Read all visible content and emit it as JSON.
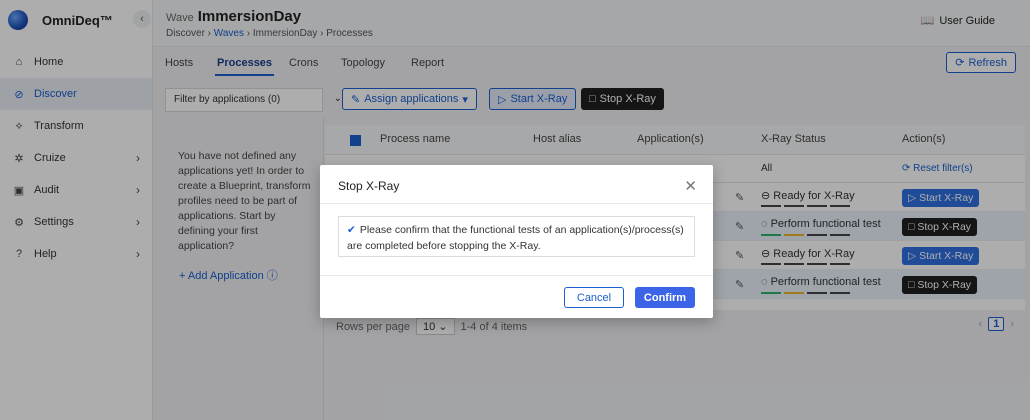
{
  "brand": {
    "name": "OmniDeq™"
  },
  "sidebar": {
    "items": [
      {
        "label": "Home",
        "icon": "home-icon"
      },
      {
        "label": "Discover",
        "icon": "discover-icon"
      },
      {
        "label": "Transform",
        "icon": "transform-icon"
      },
      {
        "label": "Cruize",
        "icon": "cruize-icon"
      },
      {
        "label": "Audit",
        "icon": "audit-icon"
      },
      {
        "label": "Settings",
        "icon": "gear-icon"
      },
      {
        "label": "Help",
        "icon": "help-icon"
      }
    ]
  },
  "header": {
    "prefix": "Wave",
    "title": "ImmersionDay",
    "breadcrumb": {
      "b1": "Discover",
      "b2": "Waves",
      "b3": "ImmersionDay",
      "b4": "Processes"
    },
    "user_guide": "User Guide"
  },
  "tabs": {
    "t1": "Hosts",
    "t2": "Processes",
    "t3": "Crons",
    "t4": "Topology",
    "t5": "Report"
  },
  "toolbar": {
    "refresh": "Refresh",
    "filter": "Filter by applications (0)",
    "assign": "Assign applications",
    "start": "Start X-Ray",
    "stop": "Stop X-Ray"
  },
  "left_panel": {
    "message": "You have not defined any applications yet! In order to create a Blueprint, transform profiles need to be part of applications. Start by defining your first application?",
    "add_app": "Add Application"
  },
  "table": {
    "headers": {
      "process": "Process name",
      "host": "Host alias",
      "apps": "Application(s)",
      "status": "X-Ray Status",
      "action": "Action(s)"
    },
    "filter_all": "All",
    "reset": "Reset filter(s)",
    "rows": [
      {
        "status": "Ready for X-Ray",
        "action": "Start X-Ray"
      },
      {
        "status": "Perform functional test",
        "action": "Stop X-Ray"
      },
      {
        "status": "Ready for X-Ray",
        "action": "Start X-Ray"
      },
      {
        "status": "Perform functional test",
        "action": "Stop X-Ray"
      }
    ]
  },
  "pager": {
    "rows_label": "Rows per page",
    "rows_value": "10",
    "range": "1-4 of 4 items",
    "page": "1"
  },
  "modal": {
    "title": "Stop X-Ray",
    "message": "Please confirm that the functional tests of an application(s)/process(s) are completed before stopping the X-Ray.",
    "cancel": "Cancel",
    "confirm": "Confirm"
  },
  "colors": {
    "accent": "#1a5fd0",
    "primary_button": "#3b65e6",
    "dark_button": "#1f1f1f"
  }
}
